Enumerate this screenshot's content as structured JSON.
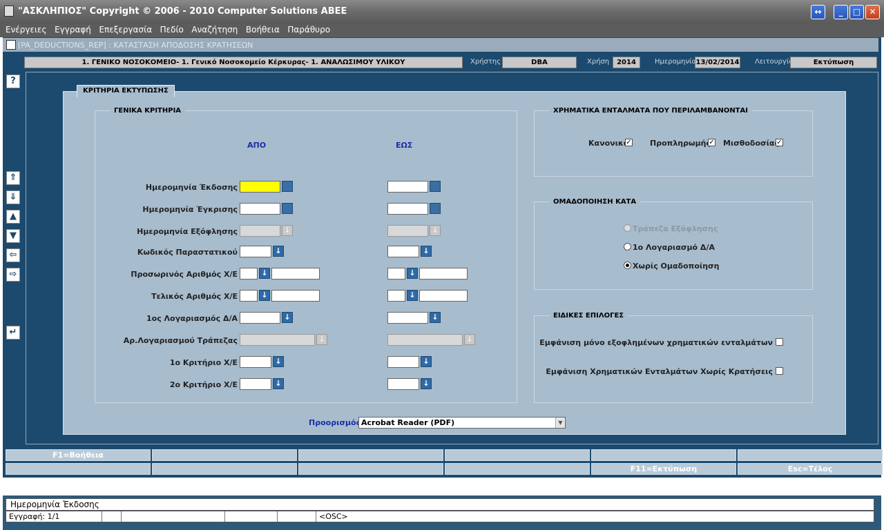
{
  "window": {
    "title": "\"ΑΣΚΛΗΠΙΟΣ\" Copyright © 2006 - 2010 Computer Solutions ABEE",
    "buttons": [
      "↔",
      "_",
      "□",
      "✕"
    ]
  },
  "menu": [
    "Ενέργειες",
    "Εγγραφή",
    "Επεξεργασία",
    "Πεδίο",
    "Αναζήτηση",
    "Βοήθεια",
    "Παράθυρο"
  ],
  "form": {
    "title": "[PA_DEDUCTIONS_REP]   :   ΚΑΤΑΣΤΑΣΗ ΑΠΟΔΟΣΗΣ ΚΡΑΤΗΣΕΩΝ"
  },
  "topbar": {
    "hospital": "1. ΓΕΝΙΚΟ ΝΟΣΟΚΟΜΕΙΟ- 1. Γενικό Νοσοκομείο Κέρκυρας- 1. ΑΝΑΛΩΣΙΜΟΥ ΥΛΙΚΟΥ",
    "user_label": "Χρήστης",
    "user": "DBA",
    "year_label": "Χρήση",
    "year": "2014",
    "date_label": "Ημερομηνία",
    "date": "13/02/2014",
    "function_label": "Λειτουργία",
    "function": "Εκτύπωση"
  },
  "nav": {
    "help": "?",
    "first": "⇑",
    "down": "⇓",
    "up": "▲",
    "next": "▼",
    "prev": "⇦",
    "forward": "⇨",
    "undo": "↵"
  },
  "panel": {
    "tab": "ΚΡΙΤΗΡΙΑ ΕΚΤΥΠΩΣΗΣ",
    "general": {
      "title": "ΓΕΝΙΚΑ ΚΡΙΤΗΡΙΑ",
      "from": "ΑΠΟ",
      "to": "ΕΩΣ",
      "rows": [
        "Ημερομηνία Έκδοσης",
        "Ημερομηνία Έγκρισης",
        "Ημερομηνία Εξόφλησης",
        "Κωδικός Παραστατικού",
        "Προσωρινός Αριθμός Χ/Ε",
        "Τελικός Αριθμός Χ/Ε",
        "1ος Λογαριασμός Δ/Α",
        "Αρ.Λογαριασμού Τράπεζας",
        "1ο Κριτήριο Χ/Ε",
        "2ο Κριτήριο Χ/Ε"
      ]
    },
    "warrants": {
      "title": "ΧΡΗΜΑΤΙΚΑ ΕΝΤΑΛΜΑΤΑ ΠΟΥ ΠΕΡΙΛΑΜΒΑΝΟΝΤΑΙ",
      "normal": "Κανονικά",
      "prepay": "Προπληρωμής",
      "payroll": "Μισθοδοσίας"
    },
    "grouping": {
      "title": "ΟΜΑΔΟΠΟΙΗΣΗ ΚΑΤΑ",
      "bank": "Τράπεζα Εξόφλησης",
      "account": "1ο Λογαριασμό Δ/Α",
      "none": "Χωρίς Ομαδοποίηση"
    },
    "special": {
      "title": "ΕΙΔΙΚΕΣ ΕΠΙΛΟΓΕΣ",
      "paid_only": "Εμφάνιση μόνο εξοφλημένων χρηματικών ενταλμάτων",
      "no_deductions": "Εμφάνιση Χρηματικών Ενταλμάτων Χωρίς Κρατήσεις"
    },
    "destination": {
      "label": "Προορισμός",
      "value": "Acrobat Reader (PDF)"
    }
  },
  "fkeys": {
    "f1": "F1=Βοήθεια",
    "f11": "F11=Εκτύπωση",
    "esc": "Esc=Τέλος"
  },
  "status": {
    "field": "Ημερομηνία Έκδοσης",
    "record": "Εγγραφή: 1/1",
    "osc": "<OSC>"
  }
}
